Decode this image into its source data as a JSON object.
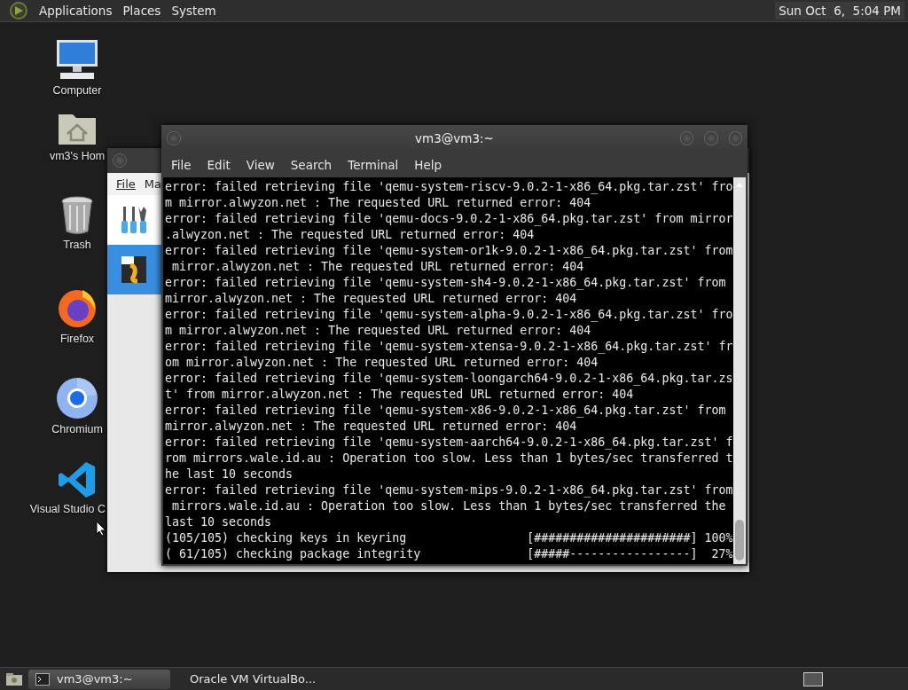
{
  "top_panel": {
    "menus": [
      "Applications",
      "Places",
      "System"
    ],
    "clock": "Sun Oct  6,  5:04 PM"
  },
  "desktop_icons": [
    {
      "label": "Computer",
      "kind": "computer"
    },
    {
      "label": "vm3's Hom",
      "kind": "home"
    },
    {
      "label": "Trash",
      "kind": "trash"
    },
    {
      "label": "Firefox",
      "kind": "firefox"
    },
    {
      "label": "Chromium",
      "kind": "chromium"
    },
    {
      "label": "Visual Studio C",
      "kind": "vscode"
    }
  ],
  "background_window": {
    "menu": [
      "File",
      "Ma"
    ],
    "list_items": [
      {
        "kind": "tools",
        "selected": false
      },
      {
        "kind": "vm",
        "selected": true
      }
    ]
  },
  "terminal": {
    "title": "vm3@vm3:~",
    "menu": [
      "File",
      "Edit",
      "View",
      "Search",
      "Terminal",
      "Help"
    ],
    "lines": [
      "error: failed retrieving file 'qemu-system-riscv-9.0.2-1-x86_64.pkg.tar.zst' fro",
      "m mirror.alwyzon.net : The requested URL returned error: 404",
      "error: failed retrieving file 'qemu-docs-9.0.2-1-x86_64.pkg.tar.zst' from mirror",
      ".alwyzon.net : The requested URL returned error: 404",
      "error: failed retrieving file 'qemu-system-or1k-9.0.2-1-x86_64.pkg.tar.zst' from",
      " mirror.alwyzon.net : The requested URL returned error: 404",
      "error: failed retrieving file 'qemu-system-sh4-9.0.2-1-x86_64.pkg.tar.zst' from",
      "mirror.alwyzon.net : The requested URL returned error: 404",
      "error: failed retrieving file 'qemu-system-alpha-9.0.2-1-x86_64.pkg.tar.zst' fro",
      "m mirror.alwyzon.net : The requested URL returned error: 404",
      "error: failed retrieving file 'qemu-system-xtensa-9.0.2-1-x86_64.pkg.tar.zst' fr",
      "om mirror.alwyzon.net : The requested URL returned error: 404",
      "error: failed retrieving file 'qemu-system-loongarch64-9.0.2-1-x86_64.pkg.tar.zs",
      "t' from mirror.alwyzon.net : The requested URL returned error: 404",
      "error: failed retrieving file 'qemu-system-x86-9.0.2-1-x86_64.pkg.tar.zst' from",
      "mirror.alwyzon.net : The requested URL returned error: 404",
      "error: failed retrieving file 'qemu-system-aarch64-9.0.2-1-x86_64.pkg.tar.zst' f",
      "rom mirrors.wale.id.au : Operation too slow. Less than 1 bytes/sec transferred t",
      "he last 10 seconds",
      "error: failed retrieving file 'qemu-system-mips-9.0.2-1-x86_64.pkg.tar.zst' from",
      " mirrors.wale.id.au : Operation too slow. Less than 1 bytes/sec transferred the",
      "last 10 seconds",
      "(105/105) checking keys in keyring                 [######################] 100%",
      "( 61/105) checking package integrity               [#####-----------------]  27%"
    ]
  },
  "taskbar": {
    "items": [
      {
        "label": "vm3@vm3:~",
        "kind": "terminal",
        "selected": true
      },
      {
        "label": "Oracle VM VirtualBo...",
        "kind": "virtualbox",
        "selected": false
      }
    ]
  }
}
